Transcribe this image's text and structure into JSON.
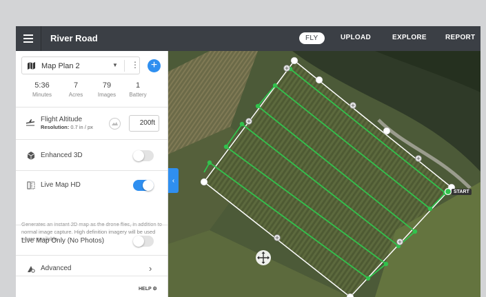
{
  "header": {
    "menu_icon": "hamburger-icon",
    "title": "River Road",
    "nav": [
      "FLY",
      "UPLOAD",
      "EXPLORE",
      "REPORT"
    ],
    "active_nav": "FLY"
  },
  "plan": {
    "map_icon": "map-icon",
    "name": "Map Plan 2",
    "caret": "▼",
    "more": "⋮",
    "add": "+"
  },
  "stats": [
    {
      "value": "5:36",
      "label": "Minutes"
    },
    {
      "value": "7",
      "label": "Acres"
    },
    {
      "value": "79",
      "label": "Images"
    },
    {
      "value": "1",
      "label": "Battery"
    }
  ],
  "altitude": {
    "label": "Flight Altitude",
    "resolution_label": "Resolution:",
    "resolution_value": "0.7 in / px",
    "value": "200ft"
  },
  "enhanced3d": {
    "label": "Enhanced 3D",
    "on": false
  },
  "livemap": {
    "label": "Live Map HD",
    "on": true,
    "description": "Generates an instant 2D map as the drone flies, in addition to normal image capture. High definition imagery will be used where available."
  },
  "livemap_only": {
    "label": "Live Map Only (No Photos)",
    "on": false
  },
  "advanced": {
    "label": "Advanced",
    "chevron": "›"
  },
  "help": {
    "label": "HELP",
    "icon": "gear-icon"
  },
  "map": {
    "start_label": "START",
    "collapse_icon": "chevron-left-icon",
    "move_icon": "move-icon",
    "route_color": "#31c24d",
    "boundary_color": "#ffffff"
  },
  "colors": {
    "accent": "#2f8ff0",
    "topbar": "#3b3f45"
  }
}
